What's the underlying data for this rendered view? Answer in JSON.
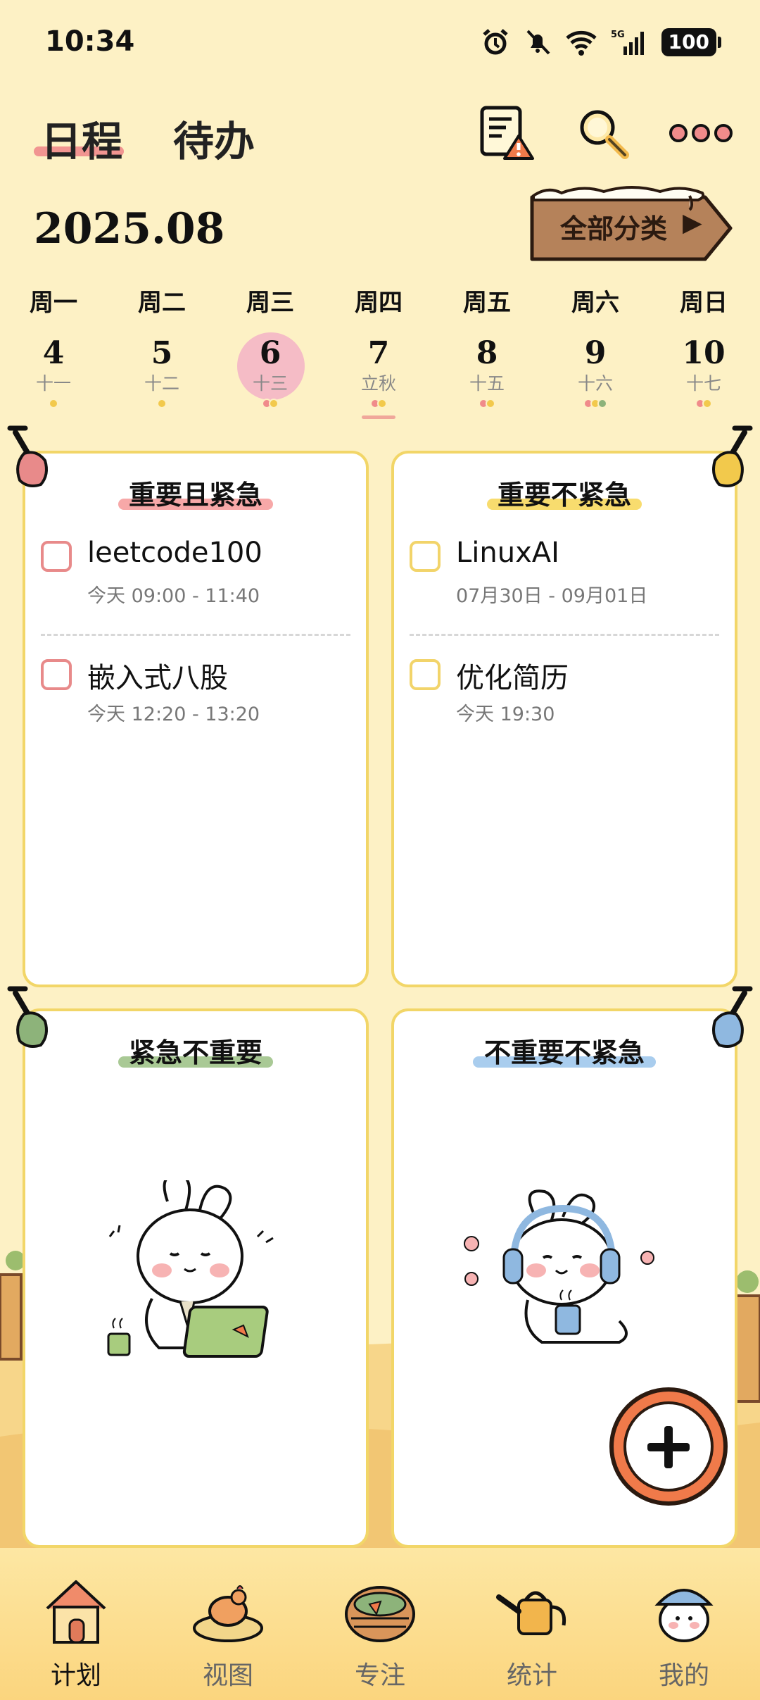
{
  "status": {
    "time": "10:34",
    "battery": "100",
    "network": "5G"
  },
  "header": {
    "tabs": [
      {
        "label": "日程",
        "active": true
      },
      {
        "label": "待办",
        "active": false
      }
    ]
  },
  "month": "2025.08",
  "category_button": {
    "label": "全部分类",
    "arrow": "▶"
  },
  "week": [
    {
      "name": "周一",
      "day": "4",
      "lunar": "十一",
      "dots": [
        "#f2c94c"
      ]
    },
    {
      "name": "周二",
      "day": "5",
      "lunar": "十二",
      "dots": [
        "#f2c94c"
      ]
    },
    {
      "name": "周三",
      "day": "6",
      "lunar": "十三",
      "dots": [
        "#f08b8b",
        "#f2c94c"
      ],
      "today": true
    },
    {
      "name": "周四",
      "day": "7",
      "lunar": "立秋",
      "dots": [
        "#f08b8b",
        "#f2c94c"
      ]
    },
    {
      "name": "周五",
      "day": "8",
      "lunar": "十五",
      "dots": [
        "#f08b8b",
        "#f2c94c"
      ]
    },
    {
      "name": "周六",
      "day": "9",
      "lunar": "十六",
      "dots": [
        "#f08b8b",
        "#f2c94c",
        "#8db37a"
      ]
    },
    {
      "name": "周日",
      "day": "10",
      "lunar": "十七",
      "dots": [
        "#f08b8b",
        "#f2c94c"
      ]
    }
  ],
  "quadrants": [
    {
      "title": "重要且紧急",
      "color": "#e88a8a",
      "highlight": "#f7a8a8",
      "tasks": [
        {
          "title": "leetcode100",
          "time": "今天  09:00 - 11:40"
        },
        {
          "title": "嵌入式八股",
          "time": "今天  12:20 - 13:20"
        }
      ]
    },
    {
      "title": "重要不紧急",
      "color": "#f2d46a",
      "highlight": "#f8dc6e",
      "tasks": [
        {
          "title": "LinuxAI",
          "time": "07月30日 - 09月01日"
        },
        {
          "title": "优化简历",
          "time": "今天  19:30"
        }
      ]
    },
    {
      "title": "紧急不重要",
      "color": "#8db37a",
      "highlight": "#a9c995",
      "tasks": []
    },
    {
      "title": "不重要不紧急",
      "color": "#8fb8e0",
      "highlight": "#a9cdee",
      "tasks": []
    }
  ],
  "nav": [
    {
      "label": "计划",
      "icon": "house-icon",
      "active": true
    },
    {
      "label": "视图",
      "icon": "hen-nest-icon",
      "active": false
    },
    {
      "label": "专注",
      "icon": "vegetable-basket-icon",
      "active": false
    },
    {
      "label": "统计",
      "icon": "watering-can-icon",
      "active": false
    },
    {
      "label": "我的",
      "icon": "bunny-avatar-icon",
      "active": false
    }
  ]
}
